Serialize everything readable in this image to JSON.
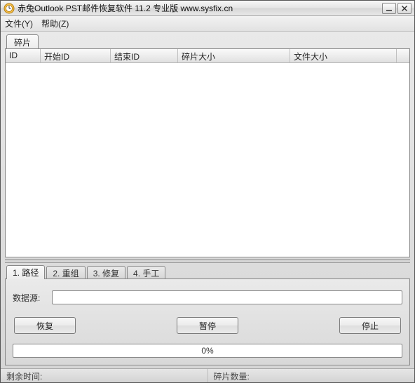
{
  "title": "赤兔Outlook PST邮件恢复软件 11.2 专业版 www.sysfix.cn",
  "menu": {
    "file": "文件(Y)",
    "help": "帮助(Z)"
  },
  "top_tab": {
    "label": "碎片"
  },
  "columns": {
    "id": "ID",
    "start_id": "开始ID",
    "end_id": "结束ID",
    "frag_size": "碎片大小",
    "file_size": "文件大小"
  },
  "bottom_tabs": {
    "t1": "1. 路径",
    "t2": "2. 重组",
    "t3": "3. 修复",
    "t4": "4. 手工"
  },
  "source_label": "数据源:",
  "source_value": "",
  "buttons": {
    "recover": "恢复",
    "pause": "暂停",
    "stop": "停止"
  },
  "progress_text": "0%",
  "status": {
    "remaining": "剩余时间:",
    "frag_count": "碎片数量:"
  }
}
